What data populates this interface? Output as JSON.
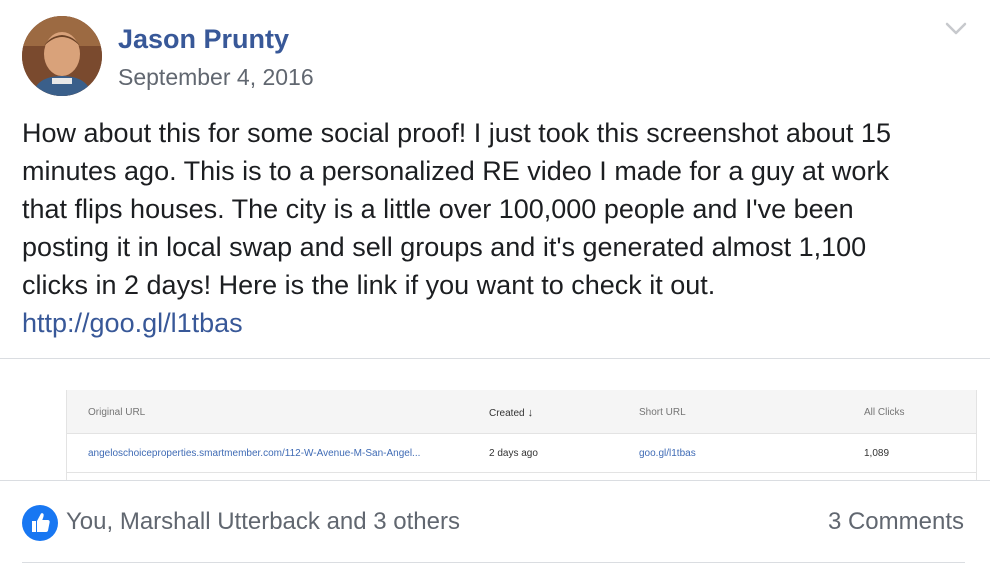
{
  "post": {
    "author": "Jason Prunty",
    "date": "September 4, 2016",
    "text_lines": [
      "How about this for some social proof! I just took this screenshot about 15",
      "minutes ago. This is to a personalized RE video I made for a guy at work",
      "that flips houses. The city is a little over 100,000 people and I've been",
      "posting it in local swap and sell groups and it's generated almost 1,100",
      "clicks in 2 days! Here is the link if you want to check it out."
    ],
    "link": "http://goo.gl/l1tbas",
    "menu_icon": "chevron-down-icon",
    "avatar_icon": "profile-photo"
  },
  "screenshot_table": {
    "headers": {
      "original_url": "Original URL",
      "created": "Created",
      "short_url": "Short URL",
      "all_clicks": "All Clicks"
    },
    "sort_icon": "arrow-down-icon",
    "row": {
      "original_url": "angeloschoiceproperties.smartmember.com/112-W-Avenue-M-San-Angel...",
      "created": "2 days ago",
      "short_url": "goo.gl/l1tbas",
      "all_clicks": "1,089"
    }
  },
  "footer": {
    "reactors": "You, Marshall Utterback and 3 others",
    "comments": "3 Comments",
    "like_icon": "thumbs-up-icon"
  },
  "colors": {
    "link": "#385898",
    "like": "#1877f2",
    "secondary_text": "#616770"
  }
}
